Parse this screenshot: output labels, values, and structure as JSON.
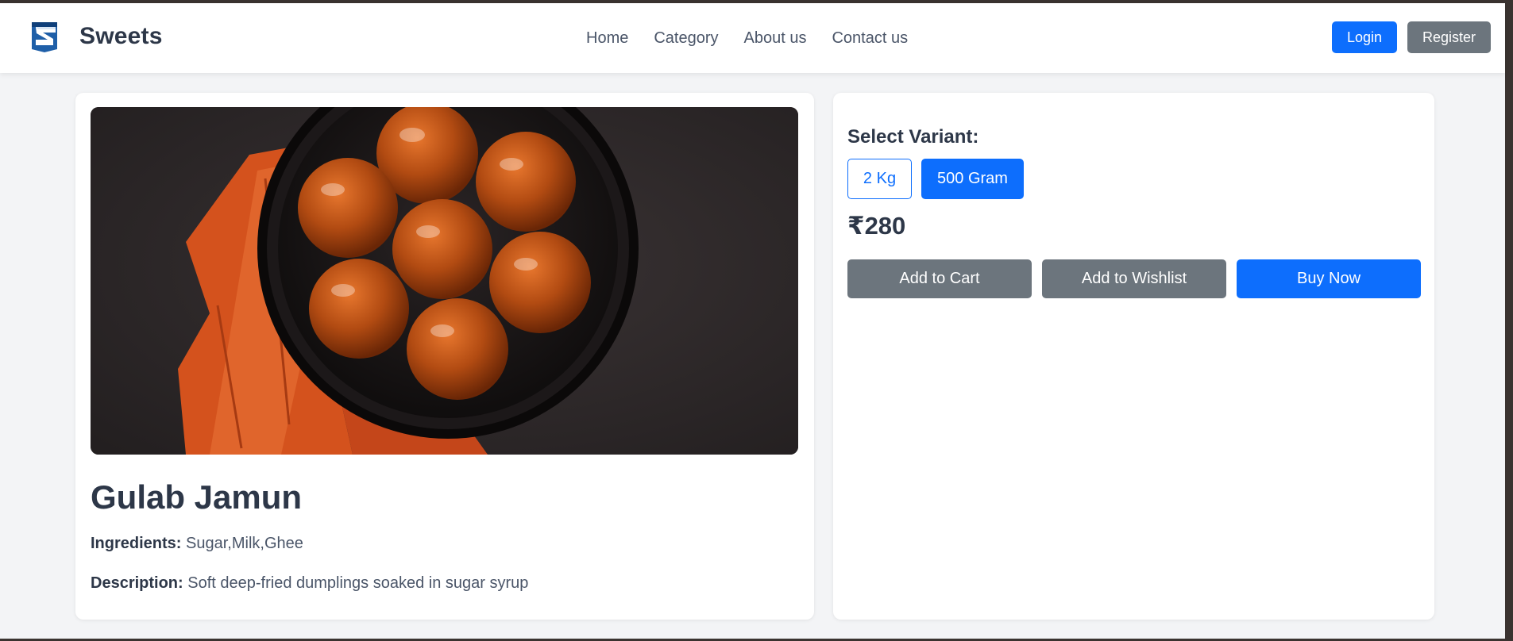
{
  "brand": {
    "name": "Sweets",
    "logo_icon": "s-shield-logo-icon"
  },
  "nav": {
    "links": [
      "Home",
      "Category",
      "About us",
      "Contact us"
    ]
  },
  "auth": {
    "login_label": "Login",
    "register_label": "Register"
  },
  "product": {
    "name": "Gulab Jamun",
    "image_alt": "Gulab Jamun",
    "ingredients_label": "Ingredients:",
    "ingredients": "Sugar,Milk,Ghee",
    "description_label": "Description:",
    "description": "Soft deep-fried dumplings soaked in sugar syrup"
  },
  "purchase": {
    "variant_heading": "Select Variant:",
    "variants": [
      {
        "label": "2 Kg",
        "selected": false
      },
      {
        "label": "500 Gram",
        "selected": true
      }
    ],
    "price": "₹280",
    "buttons": {
      "add_to_cart": "Add to Cart",
      "add_to_wishlist": "Add to Wishlist",
      "buy_now": "Buy Now"
    }
  },
  "colors": {
    "primary": "#0d6efd",
    "secondary": "#6c757d",
    "page_bg": "#f3f4f6",
    "text_dark": "#2d3748"
  }
}
